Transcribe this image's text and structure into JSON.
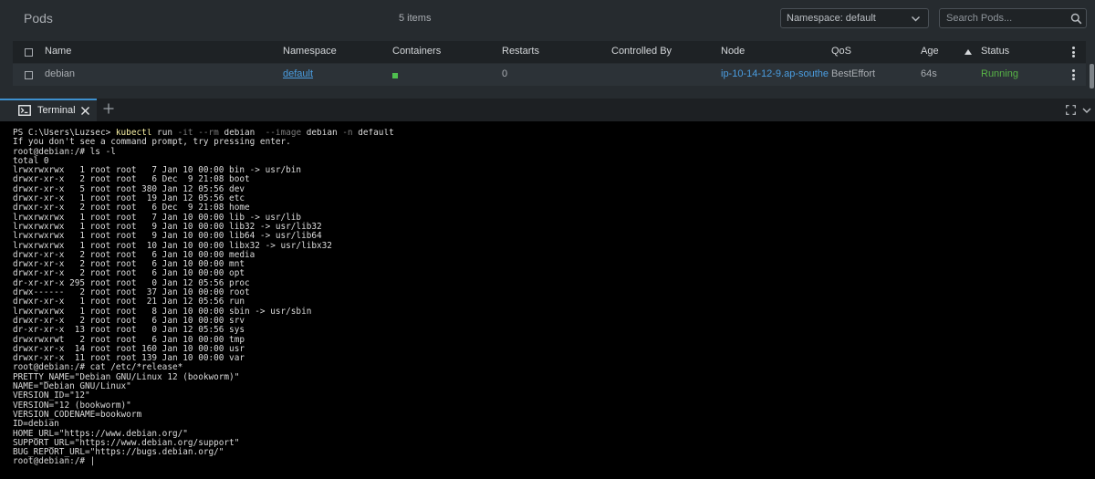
{
  "header": {
    "title": "Pods",
    "count": "5 items"
  },
  "namespace_select": {
    "value": "Namespace: default"
  },
  "search": {
    "placeholder": "Search Pods..."
  },
  "table": {
    "columns": [
      "Name",
      "Namespace",
      "Containers",
      "Restarts",
      "Controlled By",
      "Node",
      "QoS",
      "Age",
      "Status"
    ],
    "sort_column": "Age",
    "rows": [
      {
        "name": "debian",
        "namespace": "default",
        "containers": 1,
        "restarts": "0",
        "controlled_by": "",
        "node": "ip-10-14-12-9.ap-southe",
        "qos": "BestEffort",
        "age": "64s",
        "status": "Running"
      }
    ]
  },
  "tabs": {
    "terminal": {
      "label": "Terminal"
    }
  },
  "colors": {
    "accent": "#3d90ce",
    "running": "#57b346",
    "link": "#4a9de0",
    "container_ok": "#4fbf4f"
  },
  "terminal": {
    "cmd": {
      "prompt": "PS C:\\Users\\Luzsec> ",
      "kubectl": "kubectl",
      "run": " run ",
      "it": "-it",
      "s1": " ",
      "rm": "--rm",
      "debian": " debian ",
      "image": " --image",
      "img_val": " debian ",
      "n": "-n",
      "ns": " default"
    },
    "lines": [
      "If you don't see a command prompt, try pressing enter.",
      "root@debian:/# ls -l",
      "total 0",
      "lrwxrwxrwx   1 root root   7 Jan 10 00:00 bin -> usr/bin",
      "drwxr-xr-x   2 root root   6 Dec  9 21:08 boot",
      "drwxr-xr-x   5 root root 380 Jan 12 05:56 dev",
      "drwxr-xr-x   1 root root  19 Jan 12 05:56 etc",
      "drwxr-xr-x   2 root root   6 Dec  9 21:08 home",
      "lrwxrwxrwx   1 root root   7 Jan 10 00:00 lib -> usr/lib",
      "lrwxrwxrwx   1 root root   9 Jan 10 00:00 lib32 -> usr/lib32",
      "lrwxrwxrwx   1 root root   9 Jan 10 00:00 lib64 -> usr/lib64",
      "lrwxrwxrwx   1 root root  10 Jan 10 00:00 libx32 -> usr/libx32",
      "drwxr-xr-x   2 root root   6 Jan 10 00:00 media",
      "drwxr-xr-x   2 root root   6 Jan 10 00:00 mnt",
      "drwxr-xr-x   2 root root   6 Jan 10 00:00 opt",
      "dr-xr-xr-x 295 root root   0 Jan 12 05:56 proc",
      "drwx------   2 root root  37 Jan 10 00:00 root",
      "drwxr-xr-x   1 root root  21 Jan 12 05:56 run",
      "lrwxrwxrwx   1 root root   8 Jan 10 00:00 sbin -> usr/sbin",
      "drwxr-xr-x   2 root root   6 Jan 10 00:00 srv",
      "dr-xr-xr-x  13 root root   0 Jan 12 05:56 sys",
      "drwxrwxrwt   2 root root   6 Jan 10 00:00 tmp",
      "drwxr-xr-x  14 root root 160 Jan 10 00:00 usr",
      "drwxr-xr-x  11 root root 139 Jan 10 00:00 var",
      "root@debian:/# cat /etc/*release*",
      "PRETTY_NAME=\"Debian GNU/Linux 12 (bookworm)\"",
      "NAME=\"Debian GNU/Linux\"",
      "VERSION_ID=\"12\"",
      "VERSION=\"12 (bookworm)\"",
      "VERSION_CODENAME=bookworm",
      "ID=debian",
      "HOME_URL=\"https://www.debian.org/\"",
      "SUPPORT_URL=\"https://www.debian.org/support\"",
      "BUG_REPORT_URL=\"https://bugs.debian.org/\"",
      "root@debian:/# |"
    ]
  }
}
